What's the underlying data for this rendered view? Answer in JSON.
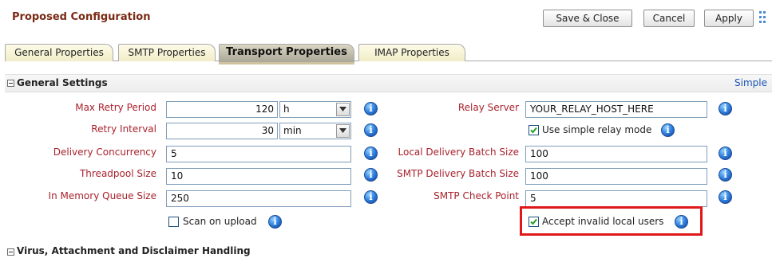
{
  "header": {
    "title": "Proposed Configuration",
    "buttons": {
      "save_close": "Save & Close",
      "cancel": "Cancel",
      "apply": "Apply"
    }
  },
  "tabs": [
    {
      "label": "General Properties",
      "active": false
    },
    {
      "label": "SMTP Properties",
      "active": false
    },
    {
      "label": "Transport Properties",
      "active": true
    },
    {
      "label": "IMAP Properties",
      "active": false
    }
  ],
  "general_settings": {
    "title": "General Settings",
    "simple_link": "Simple",
    "left_fields": {
      "max_retry_period": {
        "label": "Max Retry Period",
        "value": "120",
        "unit": "h"
      },
      "retry_interval": {
        "label": "Retry Interval",
        "value": "30",
        "unit": "min"
      },
      "delivery_concurrency": {
        "label": "Delivery Concurrency",
        "value": "5"
      },
      "threadpool_size": {
        "label": "Threadpool Size",
        "value": "10"
      },
      "in_memory_queue_size": {
        "label": "In Memory Queue Size",
        "value": "250"
      },
      "scan_on_upload": {
        "label": "Scan on upload",
        "checked": false
      }
    },
    "right_fields": {
      "relay_server": {
        "label": "Relay Server",
        "value": "YOUR_RELAY_HOST_HERE"
      },
      "use_simple_relay_mode": {
        "label": "Use simple relay mode",
        "checked": true
      },
      "local_delivery_batch_size": {
        "label": "Local Delivery Batch Size",
        "value": "100"
      },
      "smtp_delivery_batch_size": {
        "label": "SMTP Delivery Batch Size",
        "value": "100"
      },
      "smtp_check_point": {
        "label": "SMTP Check Point",
        "value": "5"
      },
      "accept_invalid_local_users": {
        "label": "Accept invalid local users",
        "checked": true
      }
    },
    "info_glyph": "i"
  },
  "virus_section": {
    "title": "Virus, Attachment and Disclaimer Handling"
  },
  "colors": {
    "title": "#7a2a14",
    "field_label": "#a8222c",
    "link": "#1a53b5",
    "highlight": "#e01818"
  }
}
